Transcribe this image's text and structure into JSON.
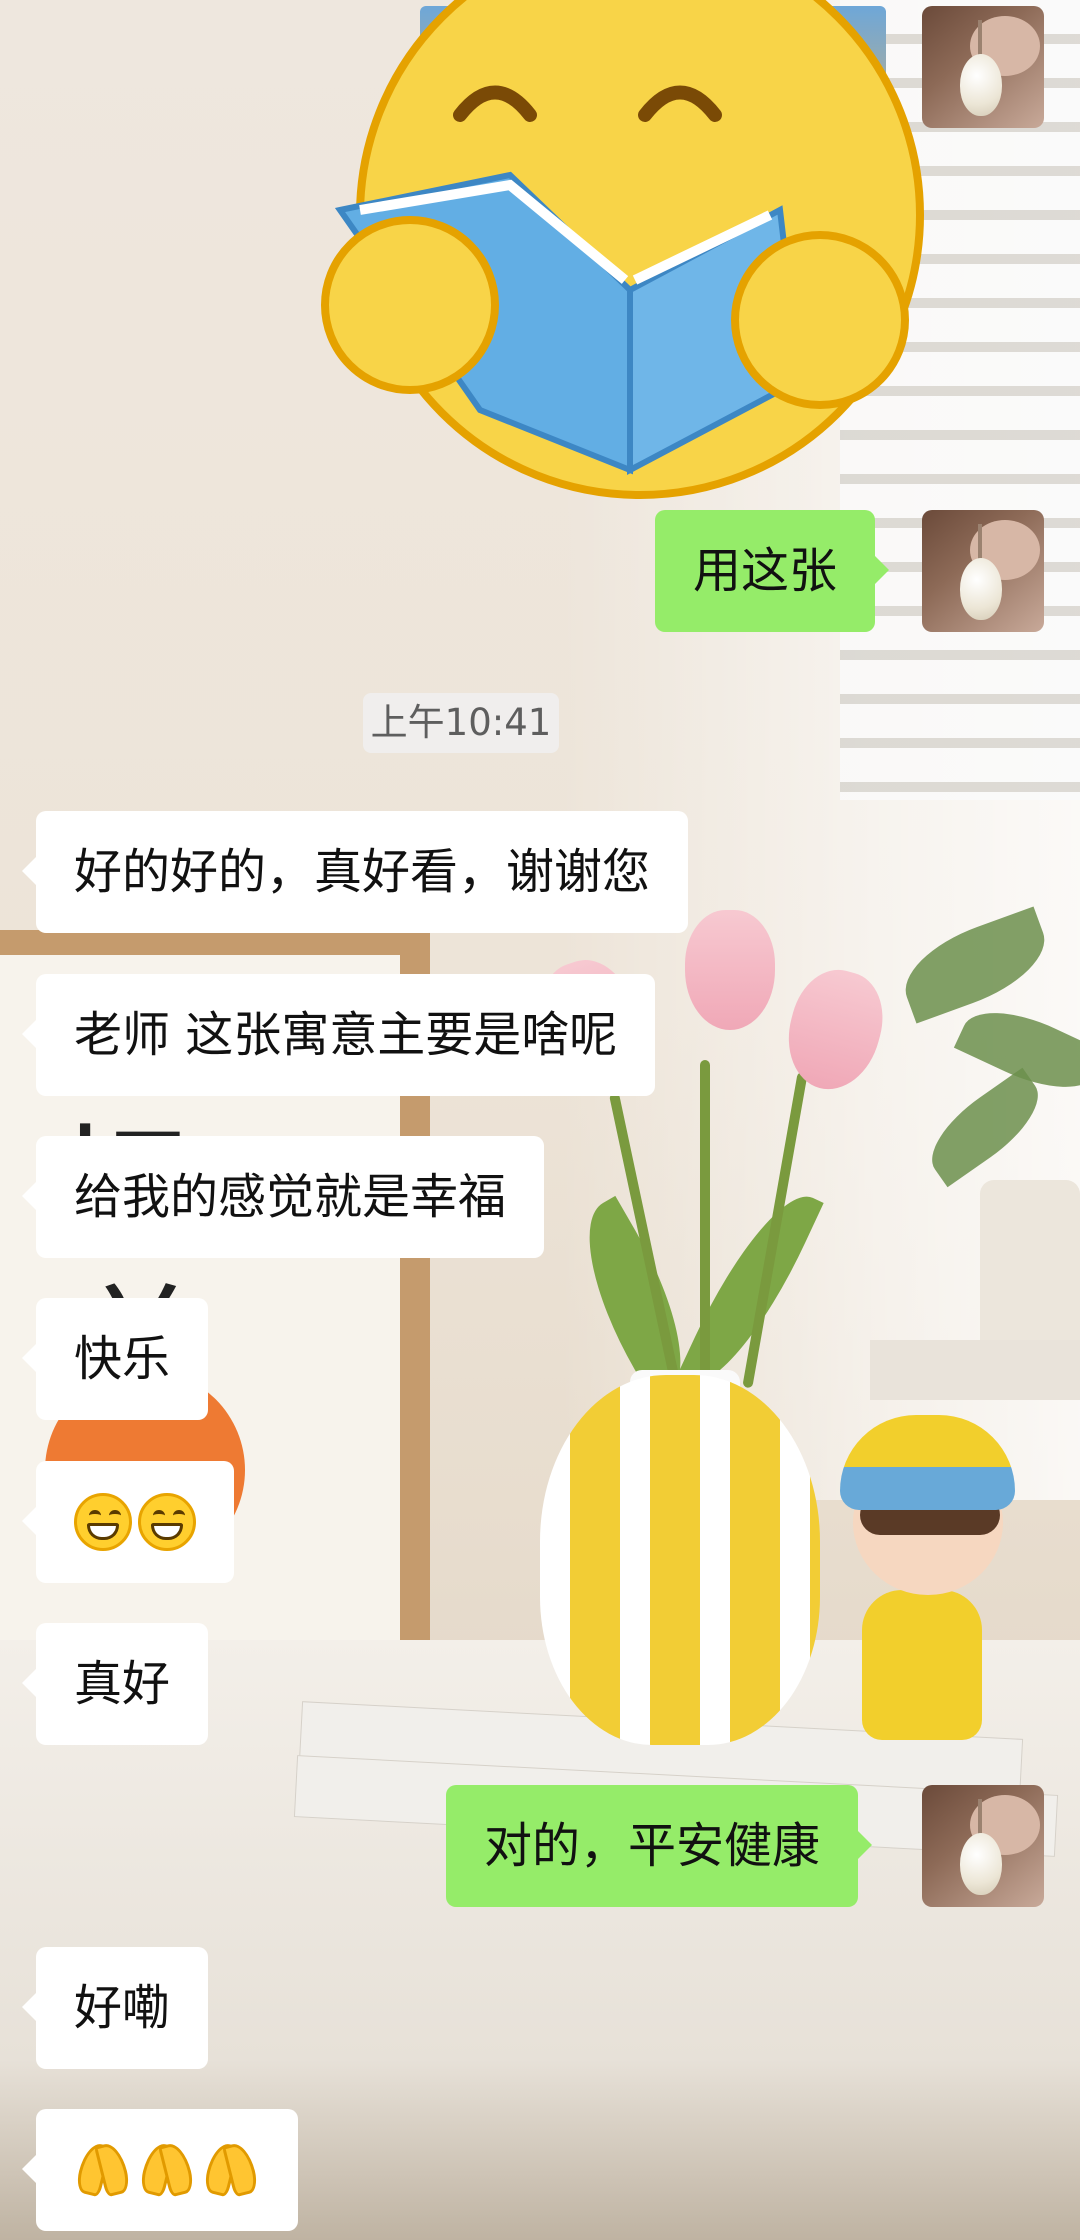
{
  "timestamp": "上午10:41",
  "messages": [
    {
      "id": "m1",
      "side": "out",
      "text": "用这张"
    },
    {
      "id": "m2",
      "side": "in",
      "text": "好的好的，真好看，谢谢您"
    },
    {
      "id": "m3",
      "side": "in",
      "text": "老师 这张寓意主要是啥呢"
    },
    {
      "id": "m4",
      "side": "in",
      "text": "给我的感觉就是幸福"
    },
    {
      "id": "m5",
      "side": "in",
      "text": "快乐"
    },
    {
      "id": "m6",
      "side": "in",
      "text": "",
      "emojis": [
        "grinning-face-icon",
        "grinning-face-icon"
      ]
    },
    {
      "id": "m7",
      "side": "in",
      "text": "真好"
    },
    {
      "id": "m8",
      "side": "out",
      "text": "对的，平安健康"
    },
    {
      "id": "m9",
      "side": "in",
      "text": "好嘞"
    },
    {
      "id": "m10",
      "side": "in",
      "text": "",
      "emojis": [
        "folded-hands-icon",
        "folded-hands-icon",
        "folded-hands-icon"
      ]
    }
  ],
  "sticker": "reading-book-emoji-sticker",
  "colors": {
    "outgoing_bubble": "#95ec69",
    "incoming_bubble": "#ffffff"
  }
}
